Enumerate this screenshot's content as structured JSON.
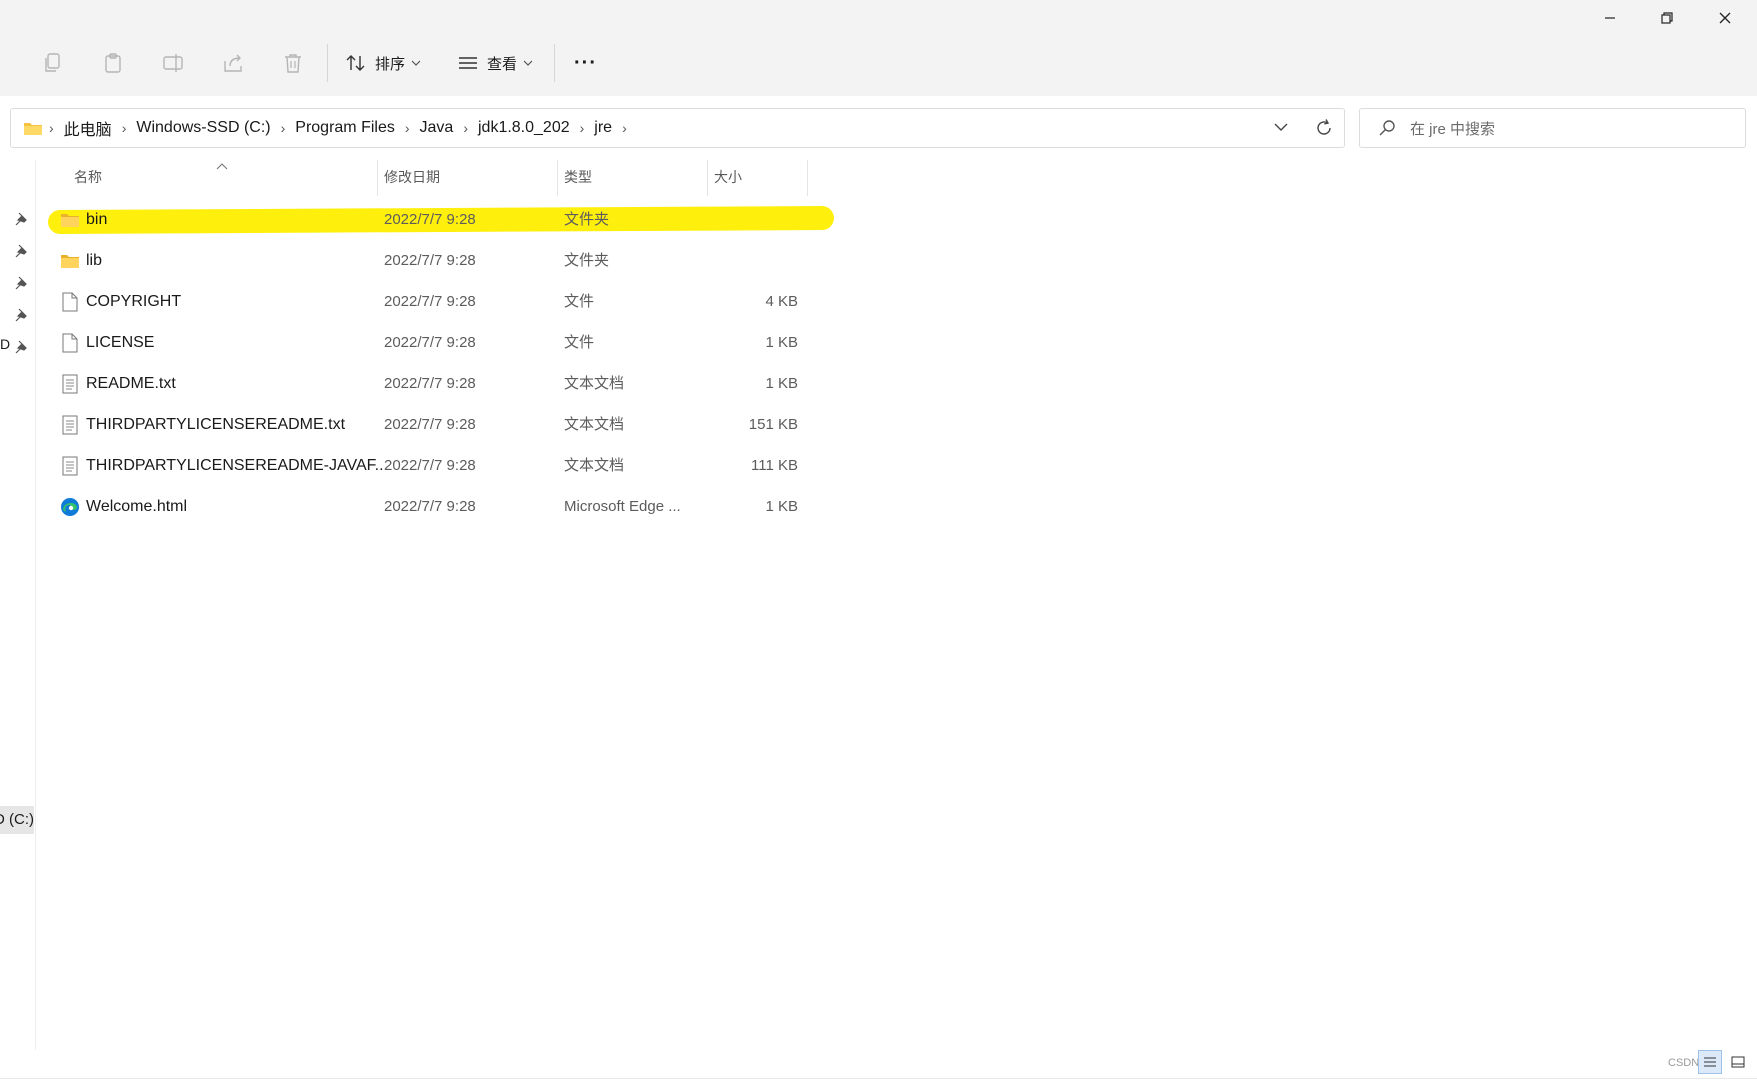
{
  "toolbar": {
    "sort_label": "排序",
    "view_label": "查看",
    "more_label": "···"
  },
  "address": {
    "crumbs": [
      "此电脑",
      "Windows-SSD (C:)",
      "Program Files",
      "Java",
      "jdk1.8.0_202",
      "jre"
    ]
  },
  "search": {
    "placeholder": "在 jre 中搜索"
  },
  "columns": {
    "name": "名称",
    "date": "修改日期",
    "type": "类型",
    "size": "大小"
  },
  "files": [
    {
      "name": "bin",
      "date": "2022/7/7 9:28",
      "type": "文件夹",
      "size": "",
      "icon": "folder-icon"
    },
    {
      "name": "lib",
      "date": "2022/7/7 9:28",
      "type": "文件夹",
      "size": "",
      "icon": "folder-icon"
    },
    {
      "name": "COPYRIGHT",
      "date": "2022/7/7 9:28",
      "type": "文件",
      "size": "4 KB",
      "icon": "file-icon"
    },
    {
      "name": "LICENSE",
      "date": "2022/7/7 9:28",
      "type": "文件",
      "size": "1 KB",
      "icon": "file-icon"
    },
    {
      "name": "README.txt",
      "date": "2022/7/7 9:28",
      "type": "文本文档",
      "size": "1 KB",
      "icon": "text-file-icon"
    },
    {
      "name": "THIRDPARTYLICENSEREADME.txt",
      "date": "2022/7/7 9:28",
      "type": "文本文档",
      "size": "151 KB",
      "icon": "text-file-icon"
    },
    {
      "name": "THIRDPARTYLICENSEREADME-JAVAF...",
      "date": "2022/7/7 9:28",
      "type": "文本文档",
      "size": "111 KB",
      "icon": "text-file-icon"
    },
    {
      "name": "Welcome.html",
      "date": "2022/7/7 9:28",
      "type": "Microsoft Edge ...",
      "size": "1 KB",
      "icon": "edge-icon"
    }
  ],
  "navpane": {
    "partial_label": "D",
    "drive_label": "D (C:)"
  },
  "watermark": "CSDN",
  "colors": {
    "highlight": "#ffee00",
    "folder": "#f4c242",
    "edge_blue": "#0f7bd8",
    "edge_green": "#34c26a"
  }
}
